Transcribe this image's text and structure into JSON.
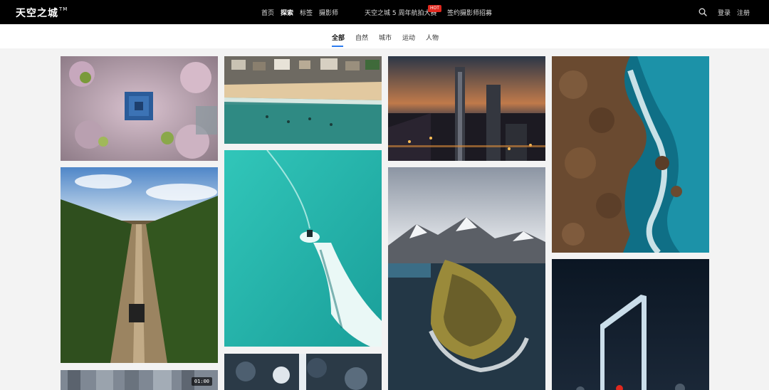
{
  "header": {
    "logo": "天空之城",
    "logo_tm": "TM",
    "nav": [
      {
        "label": "首页",
        "active": false
      },
      {
        "label": "探索",
        "active": true
      },
      {
        "label": "标签",
        "active": false
      },
      {
        "label": "摄影师",
        "active": false
      },
      {
        "label": "天空之城 5 周年航拍大赛",
        "active": false
      },
      {
        "label": "签约摄影师招募",
        "active": false
      }
    ],
    "hot_badge": "HOT",
    "login": "登录",
    "register": "注册",
    "search_icon": "search-icon"
  },
  "categories": [
    {
      "label": "全部",
      "active": true
    },
    {
      "label": "自然",
      "active": false
    },
    {
      "label": "城市",
      "active": false
    },
    {
      "label": "运动",
      "active": false
    },
    {
      "label": "人物",
      "active": false
    }
  ],
  "tiles": [
    {
      "subject": "pavilion-blossom"
    },
    {
      "subject": "forest-road"
    },
    {
      "subject": "city-towers",
      "duration": "01:00"
    },
    {
      "subject": "beach-town"
    },
    {
      "subject": "jetski-water"
    },
    {
      "subject": "snow-forest"
    },
    {
      "subject": "night-skyline"
    },
    {
      "subject": "mountain-island"
    },
    {
      "subject": "rocky-coast"
    },
    {
      "subject": "neon-frame"
    }
  ],
  "colors": {
    "accent": "#2d7cf0",
    "hot": "#e0281e",
    "topbar": "#000000",
    "background": "#f3f3f3"
  }
}
